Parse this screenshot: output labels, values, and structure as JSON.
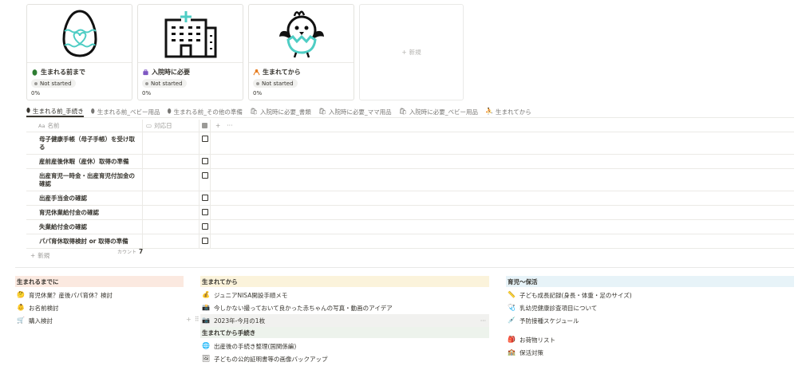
{
  "gallery": {
    "cards": [
      {
        "title": "生まれる前まで",
        "status": "Not started",
        "progress": "0%",
        "icon": "egg-icon",
        "icon_color": "#2e7d32"
      },
      {
        "title": "入院時に必要",
        "status": "Not started",
        "progress": "0%",
        "icon": "bag-icon",
        "icon_color": "#7e57c2"
      },
      {
        "title": "生まれてから",
        "status": "Not started",
        "progress": "0%",
        "icon": "baby-icon",
        "icon_color": "#e67e22"
      }
    ],
    "new_label": "新規"
  },
  "tabs": [
    {
      "label": "生まれる前_手続き",
      "active": true
    },
    {
      "label": "生まれる前_ベビー用品"
    },
    {
      "label": "生まれる前_その他の準備"
    },
    {
      "label": "入院時に必要_書類"
    },
    {
      "label": "入院時に必要_ママ用品"
    },
    {
      "label": "入院時に必要_ベビー用品"
    },
    {
      "label": "生まれてから"
    }
  ],
  "table": {
    "headers": {
      "name_prefix": "Aa",
      "name": "名前",
      "date": "対応日",
      "add": "+",
      "more": "···"
    },
    "rows": [
      {
        "name": "母子健康手帳（母子手帳）を受け取る"
      },
      {
        "name": "産前産後休暇（産休）取得の準備"
      },
      {
        "name": "出産育児一時金・出産育児付加金の確認"
      },
      {
        "name": "出産手当金の確認"
      },
      {
        "name": "育児休業給付金の確認"
      },
      {
        "name": "失業給付金の確認"
      },
      {
        "name": "パパ育休取得検討 or 取得の準備"
      }
    ],
    "new_label": "新規",
    "count_label": "カウント",
    "count_value": "7"
  },
  "columns": [
    {
      "header": "生まれるまでに",
      "header_bg": "#fbe9e0",
      "items": [
        {
          "icon": "🤔",
          "label": "育児休業？産後パパ育休？検討"
        },
        {
          "icon": "👶",
          "label": "お名前検討"
        },
        {
          "icon": "🛒",
          "label": "購入検討"
        }
      ]
    },
    {
      "header": "生まれてから",
      "header_bg": "#fbf3db",
      "items": [
        {
          "icon": "💰",
          "label": "ジュニアNISA開設手順メモ"
        },
        {
          "icon": "📸",
          "label": "今しかない撮っておいて良かった赤ちゃんの写真・動画のアイデア"
        },
        {
          "icon": "📷",
          "label": "2023年-今月の1枚",
          "more": "···"
        }
      ],
      "sub_header": "生まれてから手続き",
      "sub_header_bg": "#edf3ec",
      "sub_items": [
        {
          "icon": "🌐",
          "label": "出産後の手続き整理(国関係編)"
        },
        {
          "icon": "🖼",
          "label": "子どもの公的証明書等の画像バックアップ"
        }
      ]
    },
    {
      "header": "育児〜保活",
      "header_bg": "#e7f3f8",
      "items": [
        {
          "icon": "📏",
          "label": "子ども成長記録(身長・体重・足のサイズ)"
        },
        {
          "icon": "🩺",
          "label": "乳幼児健康診査項目について"
        },
        {
          "icon": "💉",
          "label": "予防接種スケジュール"
        }
      ],
      "items2": [
        {
          "icon": "🎒",
          "label": "お荷物リスト"
        },
        {
          "icon": "🏫",
          "label": "保活対策"
        }
      ]
    }
  ],
  "colors": {
    "text": "#37352f",
    "muted": "#9b9a97",
    "border": "#ebeae6",
    "teal": "#4ecdc4"
  }
}
